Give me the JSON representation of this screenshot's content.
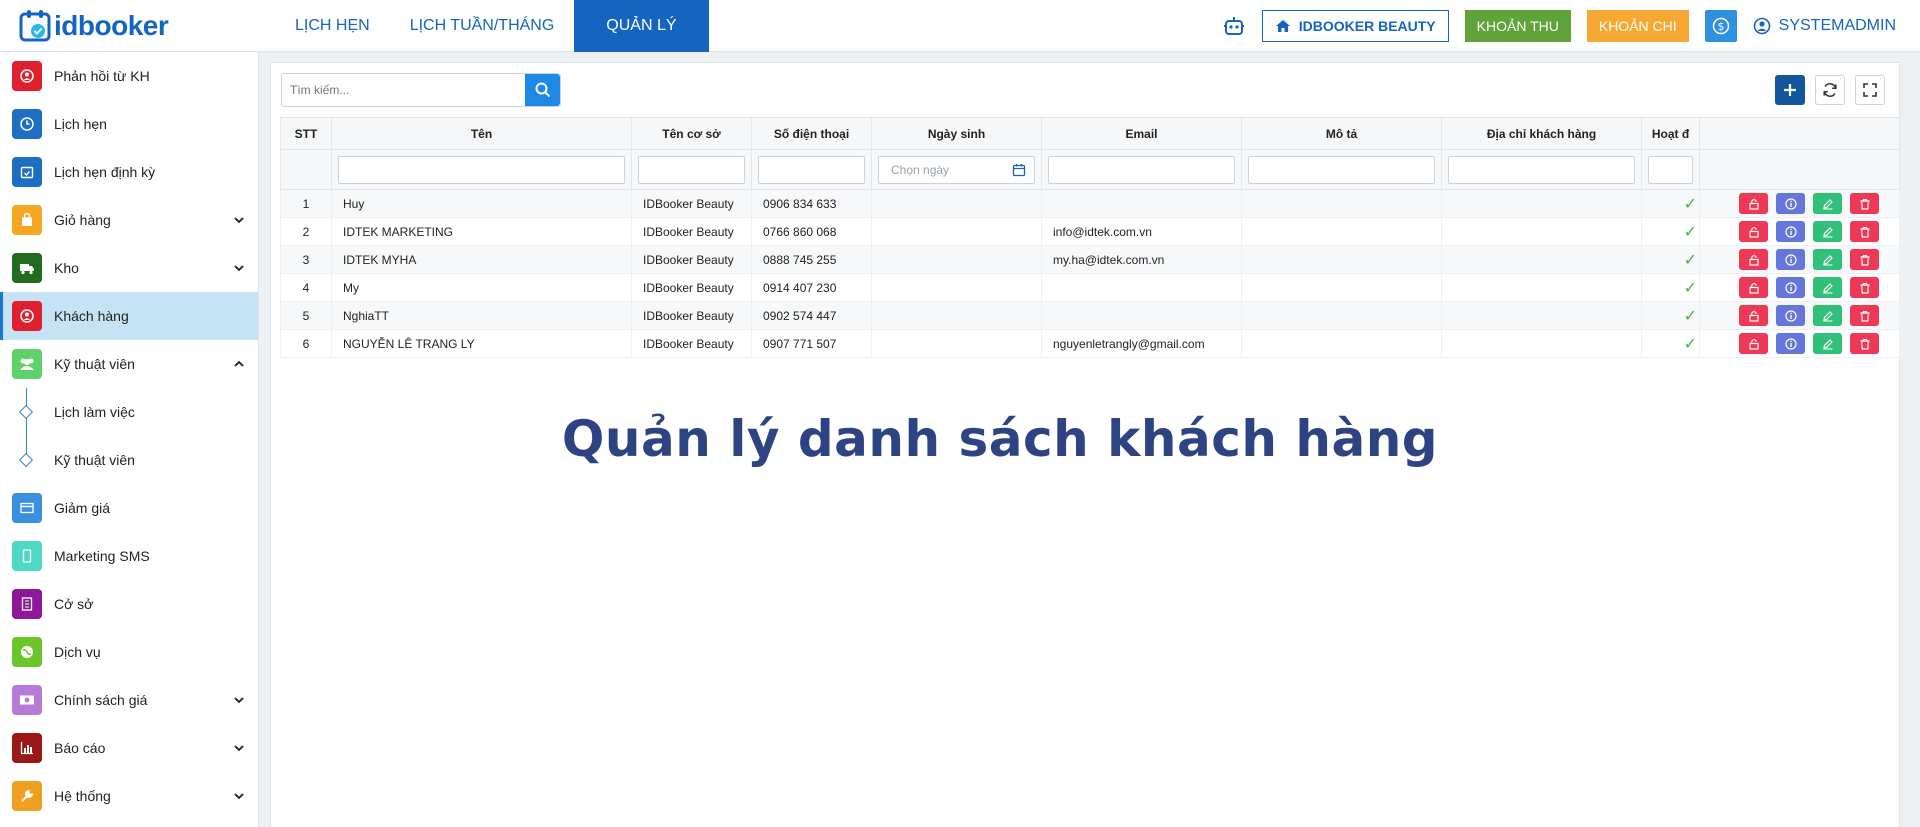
{
  "app": {
    "logo_text": "idbooker"
  },
  "nav": {
    "tabs": [
      "LỊCH HẸN",
      "LỊCH TUẦN/THÁNG",
      "QUẢN LÝ"
    ],
    "active": "QUẢN LÝ"
  },
  "top_right": {
    "branch_button": "IDBOOKER BEAUTY",
    "income_button": "KHOẢN THU",
    "expense_button": "KHOẢN CHI",
    "user_name": "SYSTEMADMIN"
  },
  "sidebar": {
    "items": [
      {
        "label": "Phản hồi từ KH",
        "icon": "user-circle-icon",
        "color": "#e0202f"
      },
      {
        "label": "Lịch hẹn",
        "icon": "clock-icon",
        "color": "#1e6fc4"
      },
      {
        "label": "Lịch hẹn định kỳ",
        "icon": "calendar-check-icon",
        "color": "#1e6fc4"
      },
      {
        "label": "Giỏ hàng",
        "icon": "shopping-bag-icon",
        "color": "#f5a623"
      },
      {
        "label": "Kho",
        "icon": "truck-icon",
        "color": "#236b1e"
      },
      {
        "label": "Khách hàng",
        "icon": "user-circle-icon",
        "color": "#e0202f"
      },
      {
        "label": "Kỹ thuật viên",
        "icon": "users-icon",
        "color": "#5fd16a"
      },
      {
        "label": "Lịch làm việc"
      },
      {
        "label": "Kỹ thuật viên"
      },
      {
        "label": "Giảm giá",
        "icon": "card-icon",
        "color": "#3a8fe0"
      },
      {
        "label": "Marketing SMS",
        "icon": "mobile-icon",
        "color": "#4fd8c4"
      },
      {
        "label": "Cở sở",
        "icon": "building-icon",
        "color": "#8d1898"
      },
      {
        "label": "Dịch vụ",
        "icon": "globe-icon",
        "color": "#6cc62a"
      },
      {
        "label": "Chính sách giá",
        "icon": "money-icon",
        "color": "#b67ad8"
      },
      {
        "label": "Báo cáo",
        "icon": "bar-chart-icon",
        "color": "#9b1818"
      },
      {
        "label": "Hệ thống",
        "icon": "wrench-icon",
        "color": "#f0a020"
      }
    ]
  },
  "search": {
    "placeholder": "Tìm kiếm..."
  },
  "table": {
    "columns": [
      "STT",
      "Tên",
      "Tên cơ sở",
      "Số điện thoại",
      "Ngày sinh",
      "Email",
      "Mô tả",
      "Địa chỉ khách hàng",
      "Hoạt đ"
    ],
    "date_placeholder": "Chọn ngày",
    "rows": [
      {
        "stt": "1",
        "name": "Huy",
        "branch": "IDBooker Beauty",
        "phone": "0906 834 633",
        "dob": "",
        "email": "",
        "desc": "",
        "address": "",
        "active": "✓"
      },
      {
        "stt": "2",
        "name": "IDTEK MARKETING",
        "branch": "IDBooker Beauty",
        "phone": "0766 860 068",
        "dob": "",
        "email": "info@idtek.com.vn",
        "desc": "",
        "address": "",
        "active": "✓"
      },
      {
        "stt": "3",
        "name": "IDTEK MYHA",
        "branch": "IDBooker Beauty",
        "phone": "0888 745 255",
        "dob": "",
        "email": "my.ha@idtek.com.vn",
        "desc": "",
        "address": "",
        "active": "✓"
      },
      {
        "stt": "4",
        "name": "My",
        "branch": "IDBooker Beauty",
        "phone": "0914 407 230",
        "dob": "",
        "email": "",
        "desc": "",
        "address": "",
        "active": "✓"
      },
      {
        "stt": "5",
        "name": "NghiaTT",
        "branch": "IDBooker Beauty",
        "phone": "0902 574 447",
        "dob": "",
        "email": "",
        "desc": "",
        "address": "",
        "active": "✓"
      },
      {
        "stt": "6",
        "name": "NGUYỄN LÊ TRANG LY",
        "branch": "IDBooker Beauty",
        "phone": "0907 771 507",
        "dob": "",
        "email": "nguyenletrangly@gmail.com",
        "desc": "",
        "address": "",
        "active": "✓"
      }
    ]
  },
  "overlay_title": "Quản lý danh sách khách hàng"
}
